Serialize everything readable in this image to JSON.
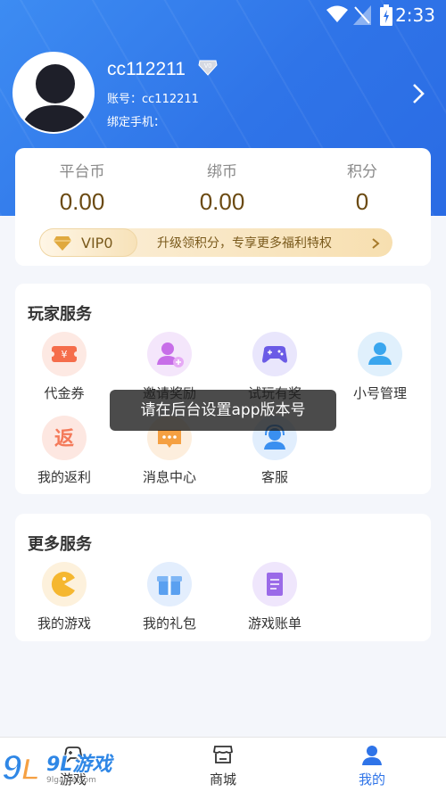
{
  "status_bar": {
    "time": "2:33",
    "wifi_icon": "wifi-icon",
    "signal_icon": "no-signal-icon",
    "battery_icon": "battery-charging-icon"
  },
  "profile": {
    "username": "cc112211",
    "vip_badge_text": "V0",
    "account_line": "账号：cc112211",
    "phone_line": "绑定手机：",
    "avatar_icon": "default-avatar-icon"
  },
  "wallet": {
    "items": [
      {
        "label": "平台币",
        "value": "0.00"
      },
      {
        "label": "绑币",
        "value": "0.00"
      },
      {
        "label": "积分",
        "value": "0"
      }
    ],
    "vip_bar": {
      "level": "VIP0",
      "promo": "升级领积分，专享更多福利特权"
    }
  },
  "player_services": {
    "title": "玩家服务",
    "items": [
      {
        "label": "代金券",
        "icon": "voucher-icon",
        "color": "#f56d4b"
      },
      {
        "label": "邀请奖励",
        "icon": "invite-user-icon",
        "color": "#c76ee8"
      },
      {
        "label": "试玩有奖",
        "icon": "gamepad-icon",
        "color": "#6b5be6"
      },
      {
        "label": "小号管理",
        "icon": "account-icon",
        "color": "#3aa6ee"
      },
      {
        "label": "我的返利",
        "icon": "rebate-icon",
        "color": "#f47a5a",
        "glyph": "返"
      },
      {
        "label": "消息中心",
        "icon": "message-icon",
        "color": "#f5a042"
      },
      {
        "label": "客服",
        "icon": "customer-service-icon",
        "color": "#3a8ff0"
      }
    ]
  },
  "more_services": {
    "title": "更多服务",
    "items": [
      {
        "label": "我的游戏",
        "icon": "my-games-icon",
        "color": "#f5b730"
      },
      {
        "label": "我的礼包",
        "icon": "gift-icon",
        "color": "#5aa0f0"
      },
      {
        "label": "游戏账单",
        "icon": "bill-icon",
        "color": "#9a6ae8"
      }
    ]
  },
  "toast": {
    "message": "请在后台设置app版本号"
  },
  "tabbar": {
    "tabs": [
      {
        "label": "游戏",
        "icon": "gamepad-tab-icon"
      },
      {
        "label": "商城",
        "icon": "store-icon"
      },
      {
        "label": "我的",
        "icon": "profile-tab-icon",
        "active": true
      }
    ]
  },
  "watermark": {
    "text": "9L游戏",
    "url": "9lgame.com"
  }
}
